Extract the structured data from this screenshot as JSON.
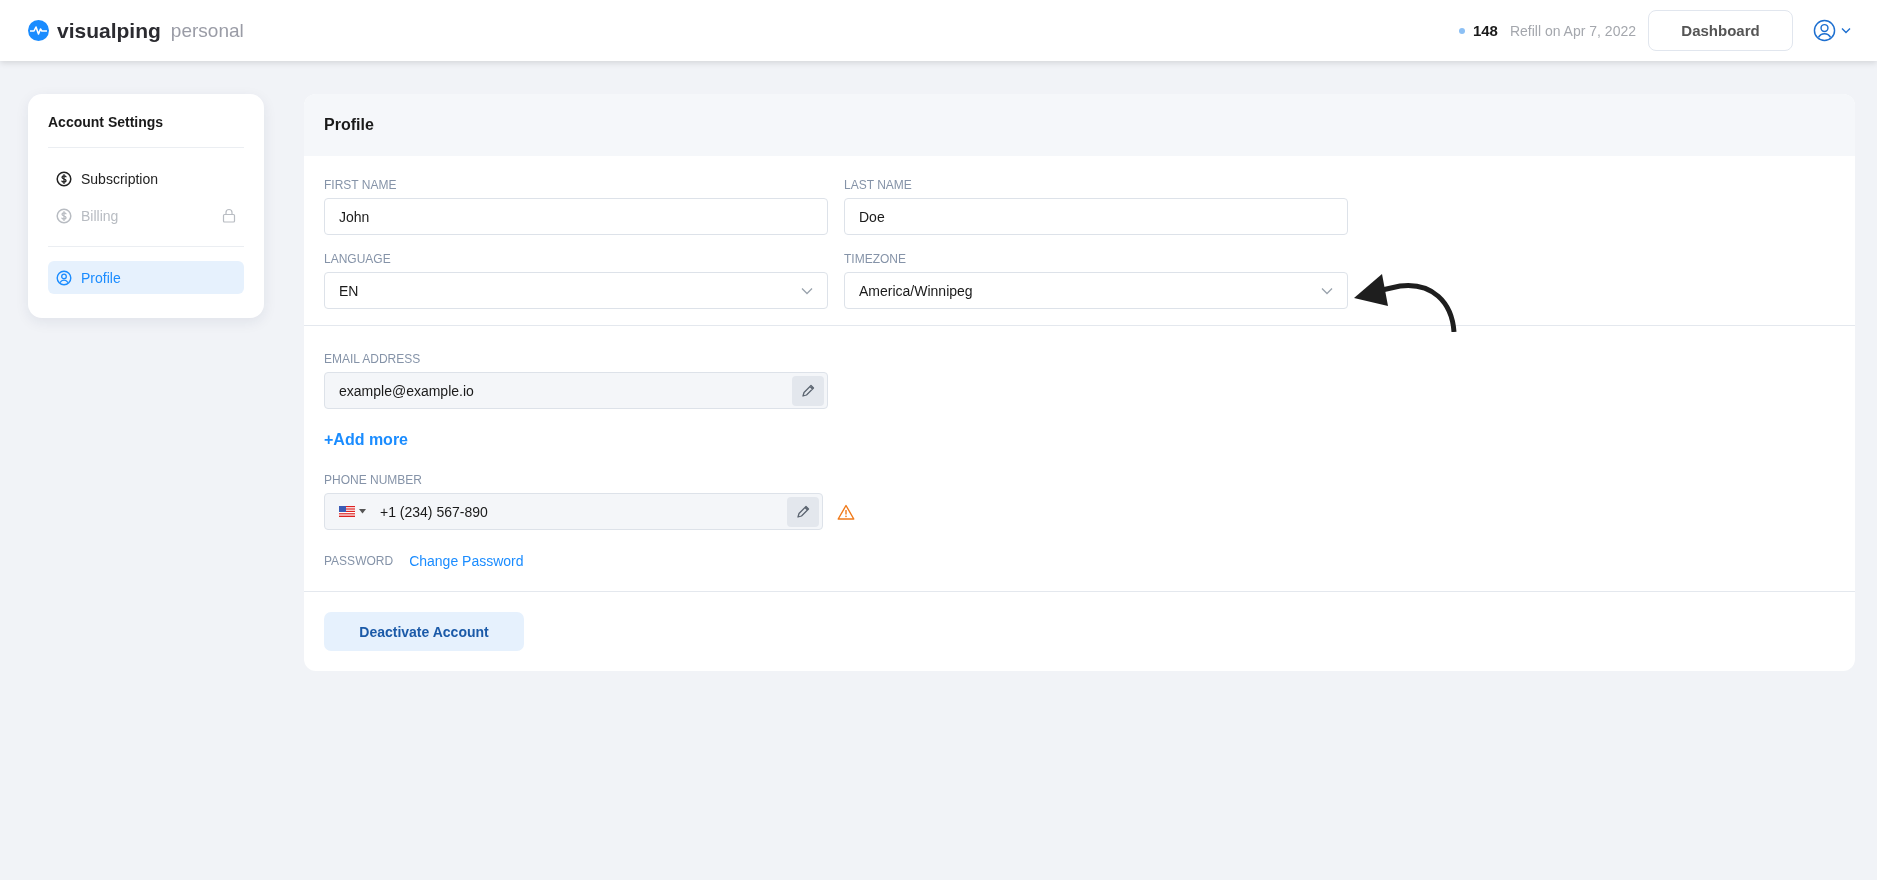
{
  "header": {
    "logo": {
      "name": "visualping",
      "plan": "personal"
    },
    "credits": "148",
    "refill": "Refill on Apr 7, 2022",
    "dashboard_button": "Dashboard"
  },
  "sidebar": {
    "title": "Account Settings",
    "sections": [
      {
        "items": [
          {
            "label": "Subscription",
            "kind": "money",
            "selected": false,
            "disabled": false
          },
          {
            "label": "Billing",
            "kind": "money",
            "selected": false,
            "disabled": true
          }
        ]
      },
      {
        "items": [
          {
            "label": "Profile",
            "kind": "person",
            "selected": true,
            "disabled": false
          }
        ]
      }
    ]
  },
  "profile": {
    "title": "Profile",
    "fields": [
      {
        "label": "FIRST NAME",
        "kind": "text",
        "value": "John"
      },
      {
        "label": "LAST NAME",
        "kind": "text",
        "value": "Doe"
      },
      {
        "label": "LANGUAGE",
        "kind": "select",
        "value": "EN"
      },
      {
        "label": "TIMEZONE",
        "kind": "select",
        "value": "America/Winnipeg"
      }
    ],
    "email": {
      "label": "EMAIL ADDRESS",
      "value": "example@example.io"
    },
    "add_more": "+Add more",
    "phone": {
      "label": "PHONE NUMBER",
      "value": "+1 (234) 567-890",
      "warning": true
    },
    "password": {
      "label": "PASSWORD",
      "link": "Change Password"
    },
    "deactivate_button": "Deactivate Account"
  }
}
